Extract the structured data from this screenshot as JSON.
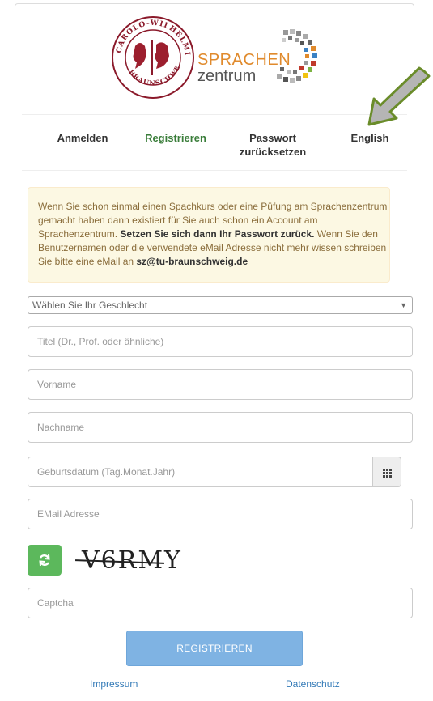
{
  "logo": {
    "seal_text": "CAROLO-WILHELMINA BRAUNSCHWEIG",
    "brand_line1": "SPRACHEN",
    "brand_line2": "zentrum"
  },
  "nav": {
    "items": [
      {
        "label": "Anmelden",
        "active": false
      },
      {
        "label": "Registrieren",
        "active": true
      },
      {
        "label": "Passwort\nzurücksetzen",
        "active": false
      },
      {
        "label": "English",
        "active": false
      }
    ]
  },
  "alert": {
    "text1": "Wenn Sie schon einmal einen Spachkurs oder eine Püfung am Sprachenzentrum gemacht haben dann existiert für Sie auch schon ein Account am Sprachenzentrum. ",
    "bold1": "Setzen Sie sich dann Ihr Passwort zurück.",
    "text2": " Wenn Sie den Benutzernamen oder die verwendete eMail Adresse nicht mehr wissen schreiben Sie bitte eine eMail an ",
    "email": "sz@tu-braunschweig.de"
  },
  "form": {
    "gender_select": "Wählen Sie Ihr Geschlecht",
    "title_placeholder": "Titel (Dr., Prof. oder ähnliche)",
    "firstname_placeholder": "Vorname",
    "lastname_placeholder": "Nachname",
    "birthdate_placeholder": "Geburtsdatum (Tag.Monat.Jahr)",
    "email_placeholder": "EMail Adresse",
    "captcha_text": "V6RMY",
    "captcha_placeholder": "Captcha",
    "submit_label": "REGISTRIEREN"
  },
  "footer": {
    "impressum": "Impressum",
    "datenschutz": "Datenschutz"
  },
  "colors": {
    "active_tab": "#3a7d3a",
    "submit_bg": "#7fb3e3",
    "refresh_bg": "#5cb85c",
    "alert_bg": "#fcf8e3",
    "link": "#337ab7"
  },
  "icons": {
    "refresh": "refresh-icon",
    "calendar": "calendar-grid-icon",
    "arrow": "pointer-arrow-icon"
  }
}
